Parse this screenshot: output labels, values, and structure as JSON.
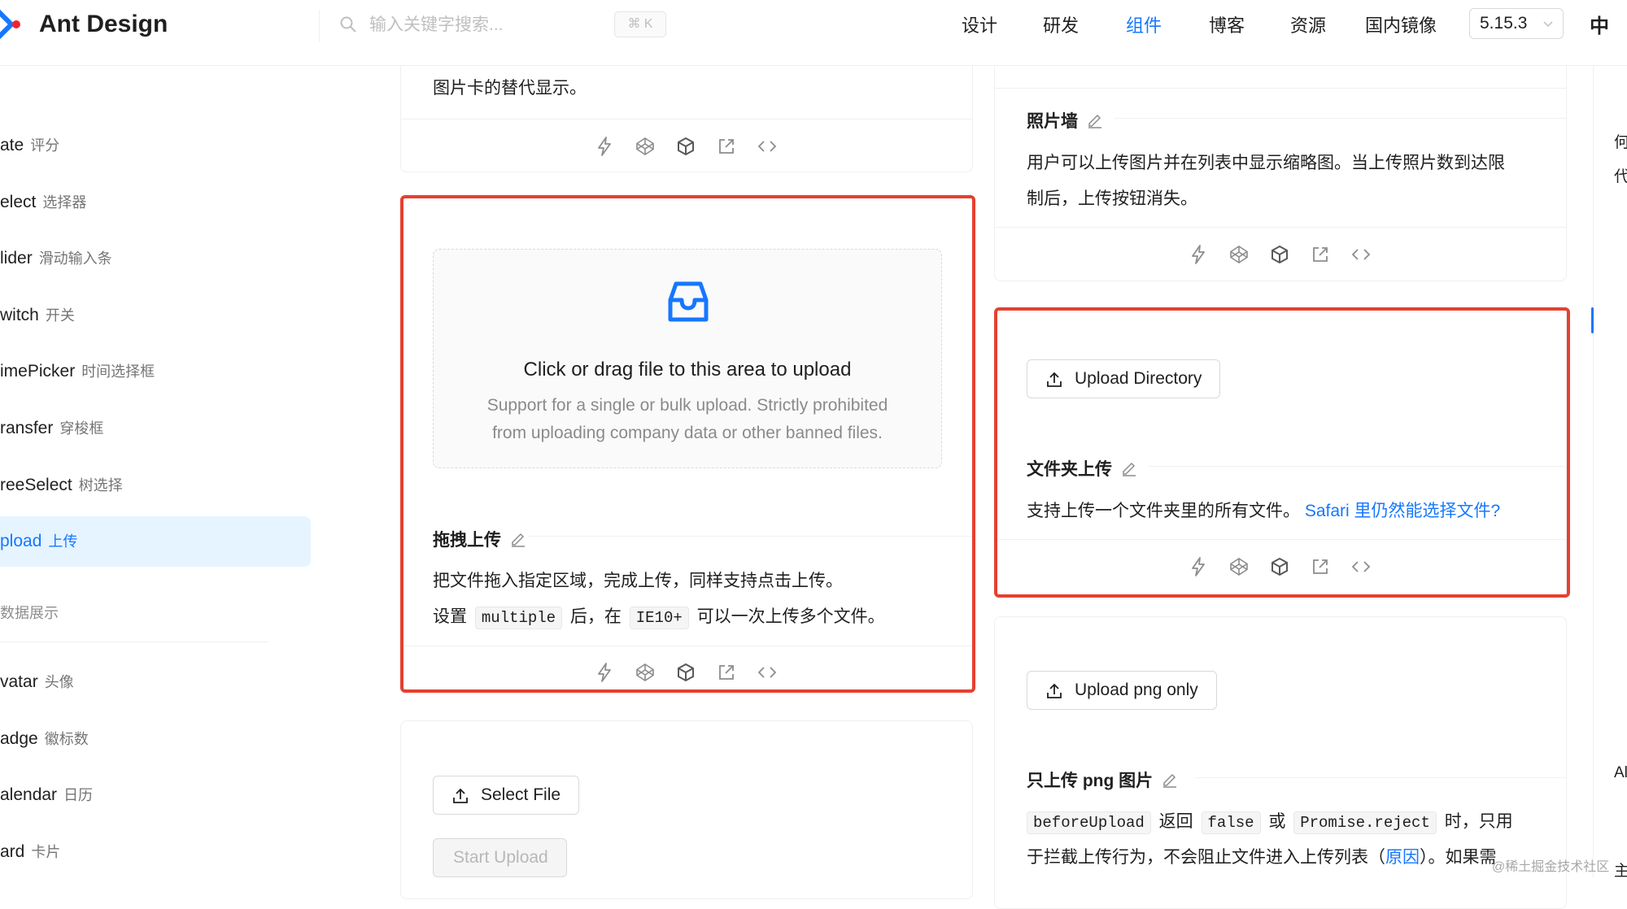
{
  "header": {
    "logo_text": "Ant Design",
    "search_placeholder": "输入关键字搜索...",
    "shortcut": "⌘ K",
    "nav": [
      "设计",
      "研发",
      "组件",
      "博客",
      "资源",
      "国内镜像"
    ],
    "active_nav": "组件",
    "version": "5.15.3",
    "lang_icon": "中"
  },
  "sidebar": {
    "items": [
      {
        "en": "ate",
        "zh": "评分"
      },
      {
        "en": "elect",
        "zh": "选择器"
      },
      {
        "en": "lider",
        "zh": "滑动输入条"
      },
      {
        "en": "witch",
        "zh": "开关"
      },
      {
        "en": "imePicker",
        "zh": "时间选择框"
      },
      {
        "en": "ransfer",
        "zh": "穿梭框"
      },
      {
        "en": "reeSelect",
        "zh": "树选择"
      },
      {
        "en": "pload",
        "zh": "上传"
      }
    ],
    "group_label": "数据展示",
    "items2": [
      {
        "en": "vatar",
        "zh": "头像"
      },
      {
        "en": "adge",
        "zh": "徽标数"
      },
      {
        "en": "alendar",
        "zh": "日历"
      },
      {
        "en": "ard",
        "zh": "卡片"
      }
    ]
  },
  "left_col": {
    "card_top_text": "图片卡的替代显示。",
    "dragger": {
      "text": "Click or drag file to this area to upload",
      "hint_line1": "Support for a single or bulk upload. Strictly prohibited",
      "hint_line2": "from uploading company data or other banned files."
    },
    "drag_title": "拖拽上传",
    "drag_desc1": "把文件拖入指定区域，完成上传，同样支持点击上传。",
    "drag_desc2_a": "设置",
    "drag_desc2_code1": "multiple",
    "drag_desc2_b": "后，在",
    "drag_desc2_code2": "IE10+",
    "drag_desc2_c": "可以一次上传多个文件。",
    "select_file": "Select File",
    "start_upload": "Start Upload"
  },
  "right_col": {
    "wall_title": "照片墙",
    "wall_desc1": "用户可以上传图片并在列表中显示缩略图。当上传照片数到达限",
    "wall_desc2": "制后，上传按钮消失。",
    "upload_directory": "Upload Directory",
    "dir_title": "文件夹上传",
    "dir_desc": "支持上传一个文件夹里的所有文件。",
    "dir_link": "Safari 里仍然能选择文件?",
    "upload_png": "Upload png only",
    "png_title": "只上传 png 图片",
    "png_code1": "beforeUpload",
    "png_t1": "返回",
    "png_code2": "false",
    "png_t2": "或",
    "png_code3": "Promise.reject",
    "png_t3": "时，只用",
    "png_line2_a": "于拦截上传行为，不会阻止文件进入上传列表（",
    "png_line2_link": "原因",
    "png_line2_b": "）。如果需"
  },
  "anchor": {
    "t1": "何",
    "t2": "代",
    "t3": "Al",
    "t4": "主"
  },
  "watermark": "@稀土掘金技术社区",
  "colors": {
    "accent": "#1677ff",
    "highlight": "#e5402f",
    "border": "#f0f0f0"
  }
}
